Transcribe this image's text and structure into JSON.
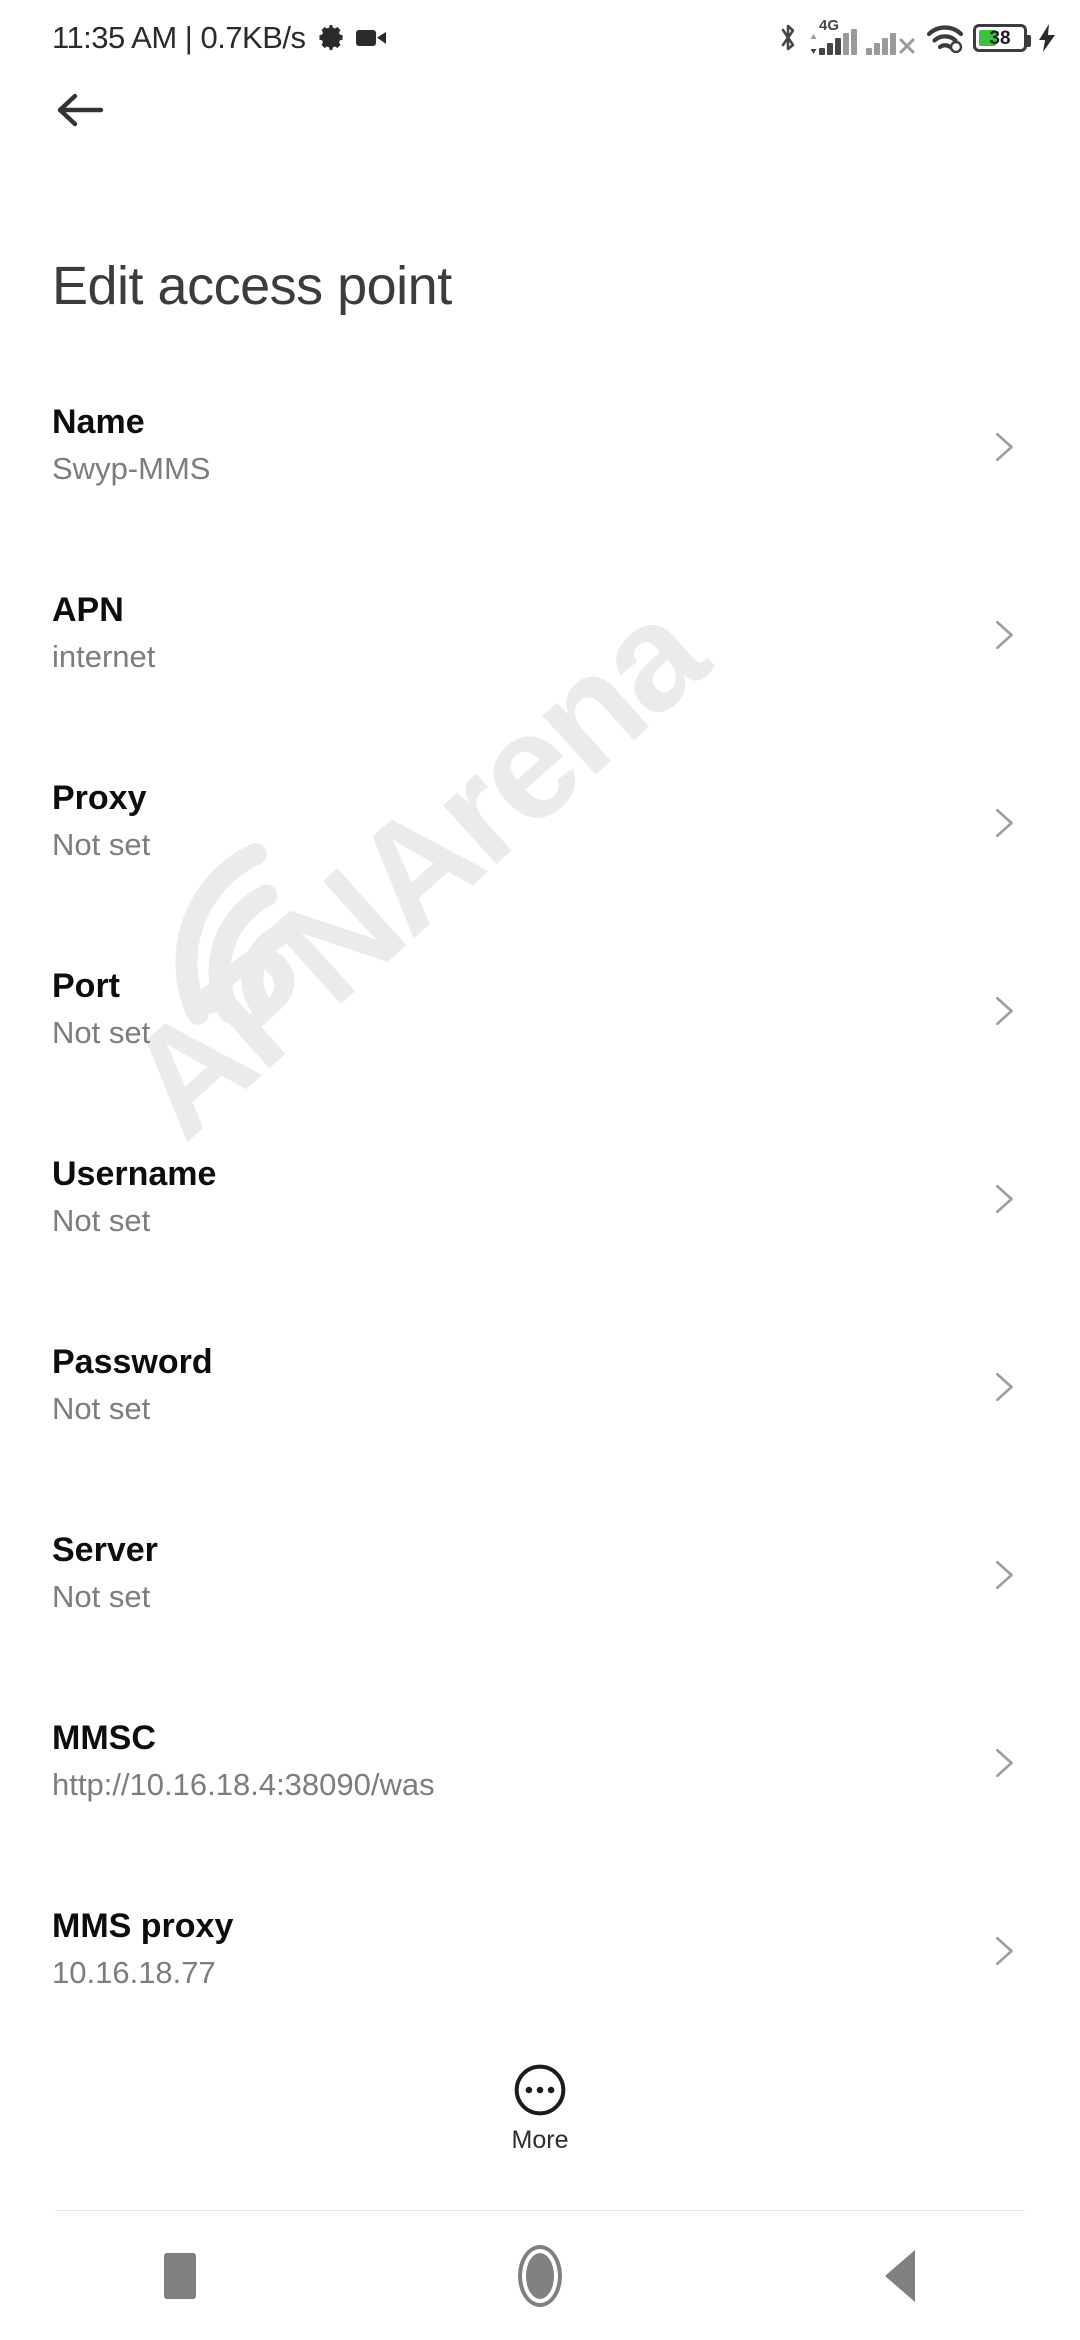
{
  "status_bar": {
    "time": "11:35 AM",
    "separator": "|",
    "network_speed": "0.7KB/s",
    "left_icons": [
      "gear-icon",
      "video-camera-icon"
    ],
    "right_icons": [
      "bluetooth-icon",
      "cellular-signal-icon",
      "cellular-signal-no-service-icon",
      "wifi-icon",
      "battery-icon",
      "charging-bolt-icon"
    ],
    "network_generation": "4G",
    "battery_level": "38",
    "battery_color": "#3ec23e",
    "charging": true
  },
  "header": {
    "back_label": "Back",
    "title": "Edit access point"
  },
  "watermark": {
    "text": "APNArena",
    "color": "#ebebeb"
  },
  "list": {
    "items": [
      {
        "title": "Name",
        "value": "Swyp-MMS"
      },
      {
        "title": "APN",
        "value": "internet"
      },
      {
        "title": "Proxy",
        "value": "Not set"
      },
      {
        "title": "Port",
        "value": "Not set"
      },
      {
        "title": "Username",
        "value": "Not set"
      },
      {
        "title": "Password",
        "value": "Not set"
      },
      {
        "title": "Server",
        "value": "Not set"
      },
      {
        "title": "MMSC",
        "value": "http://10.16.18.4:38090/was"
      },
      {
        "title": "MMS proxy",
        "value": "10.16.18.77"
      }
    ]
  },
  "bottom_bar": {
    "more_label": "More",
    "more_icon": "more-overflow-circle-icon"
  },
  "nav_bar": {
    "recents_label": "Recents",
    "home_label": "Home",
    "back_label": "Back",
    "color": "#808080"
  }
}
